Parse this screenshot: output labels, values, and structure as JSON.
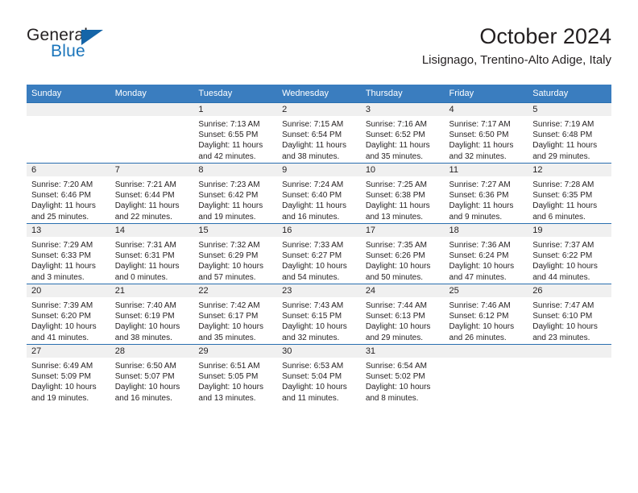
{
  "brand": {
    "name_part1": "General",
    "name_part2": "Blue",
    "logo_icon": "triangle-logo-icon"
  },
  "header": {
    "month_title": "October 2024",
    "location": "Lisignago, Trentino-Alto Adige, Italy"
  },
  "colors": {
    "header_blue": "#3a7dbf",
    "row_border_blue": "#2a6fb0",
    "daynum_strip": "#f0f0f0",
    "brand_blue": "#1b75bb",
    "text": "#231f20"
  },
  "weekday_headers": [
    "Sunday",
    "Monday",
    "Tuesday",
    "Wednesday",
    "Thursday",
    "Friday",
    "Saturday"
  ],
  "weeks": [
    [
      {
        "day": "",
        "sunrise": "",
        "sunset": "",
        "daylight_line1": "",
        "daylight_line2": ""
      },
      {
        "day": "",
        "sunrise": "",
        "sunset": "",
        "daylight_line1": "",
        "daylight_line2": ""
      },
      {
        "day": "1",
        "sunrise": "Sunrise: 7:13 AM",
        "sunset": "Sunset: 6:55 PM",
        "daylight_line1": "Daylight: 11 hours",
        "daylight_line2": "and 42 minutes."
      },
      {
        "day": "2",
        "sunrise": "Sunrise: 7:15 AM",
        "sunset": "Sunset: 6:54 PM",
        "daylight_line1": "Daylight: 11 hours",
        "daylight_line2": "and 38 minutes."
      },
      {
        "day": "3",
        "sunrise": "Sunrise: 7:16 AM",
        "sunset": "Sunset: 6:52 PM",
        "daylight_line1": "Daylight: 11 hours",
        "daylight_line2": "and 35 minutes."
      },
      {
        "day": "4",
        "sunrise": "Sunrise: 7:17 AM",
        "sunset": "Sunset: 6:50 PM",
        "daylight_line1": "Daylight: 11 hours",
        "daylight_line2": "and 32 minutes."
      },
      {
        "day": "5",
        "sunrise": "Sunrise: 7:19 AM",
        "sunset": "Sunset: 6:48 PM",
        "daylight_line1": "Daylight: 11 hours",
        "daylight_line2": "and 29 minutes."
      }
    ],
    [
      {
        "day": "6",
        "sunrise": "Sunrise: 7:20 AM",
        "sunset": "Sunset: 6:46 PM",
        "daylight_line1": "Daylight: 11 hours",
        "daylight_line2": "and 25 minutes."
      },
      {
        "day": "7",
        "sunrise": "Sunrise: 7:21 AM",
        "sunset": "Sunset: 6:44 PM",
        "daylight_line1": "Daylight: 11 hours",
        "daylight_line2": "and 22 minutes."
      },
      {
        "day": "8",
        "sunrise": "Sunrise: 7:23 AM",
        "sunset": "Sunset: 6:42 PM",
        "daylight_line1": "Daylight: 11 hours",
        "daylight_line2": "and 19 minutes."
      },
      {
        "day": "9",
        "sunrise": "Sunrise: 7:24 AM",
        "sunset": "Sunset: 6:40 PM",
        "daylight_line1": "Daylight: 11 hours",
        "daylight_line2": "and 16 minutes."
      },
      {
        "day": "10",
        "sunrise": "Sunrise: 7:25 AM",
        "sunset": "Sunset: 6:38 PM",
        "daylight_line1": "Daylight: 11 hours",
        "daylight_line2": "and 13 minutes."
      },
      {
        "day": "11",
        "sunrise": "Sunrise: 7:27 AM",
        "sunset": "Sunset: 6:36 PM",
        "daylight_line1": "Daylight: 11 hours",
        "daylight_line2": "and 9 minutes."
      },
      {
        "day": "12",
        "sunrise": "Sunrise: 7:28 AM",
        "sunset": "Sunset: 6:35 PM",
        "daylight_line1": "Daylight: 11 hours",
        "daylight_line2": "and 6 minutes."
      }
    ],
    [
      {
        "day": "13",
        "sunrise": "Sunrise: 7:29 AM",
        "sunset": "Sunset: 6:33 PM",
        "daylight_line1": "Daylight: 11 hours",
        "daylight_line2": "and 3 minutes."
      },
      {
        "day": "14",
        "sunrise": "Sunrise: 7:31 AM",
        "sunset": "Sunset: 6:31 PM",
        "daylight_line1": "Daylight: 11 hours",
        "daylight_line2": "and 0 minutes."
      },
      {
        "day": "15",
        "sunrise": "Sunrise: 7:32 AM",
        "sunset": "Sunset: 6:29 PM",
        "daylight_line1": "Daylight: 10 hours",
        "daylight_line2": "and 57 minutes."
      },
      {
        "day": "16",
        "sunrise": "Sunrise: 7:33 AM",
        "sunset": "Sunset: 6:27 PM",
        "daylight_line1": "Daylight: 10 hours",
        "daylight_line2": "and 54 minutes."
      },
      {
        "day": "17",
        "sunrise": "Sunrise: 7:35 AM",
        "sunset": "Sunset: 6:26 PM",
        "daylight_line1": "Daylight: 10 hours",
        "daylight_line2": "and 50 minutes."
      },
      {
        "day": "18",
        "sunrise": "Sunrise: 7:36 AM",
        "sunset": "Sunset: 6:24 PM",
        "daylight_line1": "Daylight: 10 hours",
        "daylight_line2": "and 47 minutes."
      },
      {
        "day": "19",
        "sunrise": "Sunrise: 7:37 AM",
        "sunset": "Sunset: 6:22 PM",
        "daylight_line1": "Daylight: 10 hours",
        "daylight_line2": "and 44 minutes."
      }
    ],
    [
      {
        "day": "20",
        "sunrise": "Sunrise: 7:39 AM",
        "sunset": "Sunset: 6:20 PM",
        "daylight_line1": "Daylight: 10 hours",
        "daylight_line2": "and 41 minutes."
      },
      {
        "day": "21",
        "sunrise": "Sunrise: 7:40 AM",
        "sunset": "Sunset: 6:19 PM",
        "daylight_line1": "Daylight: 10 hours",
        "daylight_line2": "and 38 minutes."
      },
      {
        "day": "22",
        "sunrise": "Sunrise: 7:42 AM",
        "sunset": "Sunset: 6:17 PM",
        "daylight_line1": "Daylight: 10 hours",
        "daylight_line2": "and 35 minutes."
      },
      {
        "day": "23",
        "sunrise": "Sunrise: 7:43 AM",
        "sunset": "Sunset: 6:15 PM",
        "daylight_line1": "Daylight: 10 hours",
        "daylight_line2": "and 32 minutes."
      },
      {
        "day": "24",
        "sunrise": "Sunrise: 7:44 AM",
        "sunset": "Sunset: 6:13 PM",
        "daylight_line1": "Daylight: 10 hours",
        "daylight_line2": "and 29 minutes."
      },
      {
        "day": "25",
        "sunrise": "Sunrise: 7:46 AM",
        "sunset": "Sunset: 6:12 PM",
        "daylight_line1": "Daylight: 10 hours",
        "daylight_line2": "and 26 minutes."
      },
      {
        "day": "26",
        "sunrise": "Sunrise: 7:47 AM",
        "sunset": "Sunset: 6:10 PM",
        "daylight_line1": "Daylight: 10 hours",
        "daylight_line2": "and 23 minutes."
      }
    ],
    [
      {
        "day": "27",
        "sunrise": "Sunrise: 6:49 AM",
        "sunset": "Sunset: 5:09 PM",
        "daylight_line1": "Daylight: 10 hours",
        "daylight_line2": "and 19 minutes."
      },
      {
        "day": "28",
        "sunrise": "Sunrise: 6:50 AM",
        "sunset": "Sunset: 5:07 PM",
        "daylight_line1": "Daylight: 10 hours",
        "daylight_line2": "and 16 minutes."
      },
      {
        "day": "29",
        "sunrise": "Sunrise: 6:51 AM",
        "sunset": "Sunset: 5:05 PM",
        "daylight_line1": "Daylight: 10 hours",
        "daylight_line2": "and 13 minutes."
      },
      {
        "day": "30",
        "sunrise": "Sunrise: 6:53 AM",
        "sunset": "Sunset: 5:04 PM",
        "daylight_line1": "Daylight: 10 hours",
        "daylight_line2": "and 11 minutes."
      },
      {
        "day": "31",
        "sunrise": "Sunrise: 6:54 AM",
        "sunset": "Sunset: 5:02 PM",
        "daylight_line1": "Daylight: 10 hours",
        "daylight_line2": "and 8 minutes."
      },
      {
        "day": "",
        "sunrise": "",
        "sunset": "",
        "daylight_line1": "",
        "daylight_line2": ""
      },
      {
        "day": "",
        "sunrise": "",
        "sunset": "",
        "daylight_line1": "",
        "daylight_line2": ""
      }
    ]
  ]
}
